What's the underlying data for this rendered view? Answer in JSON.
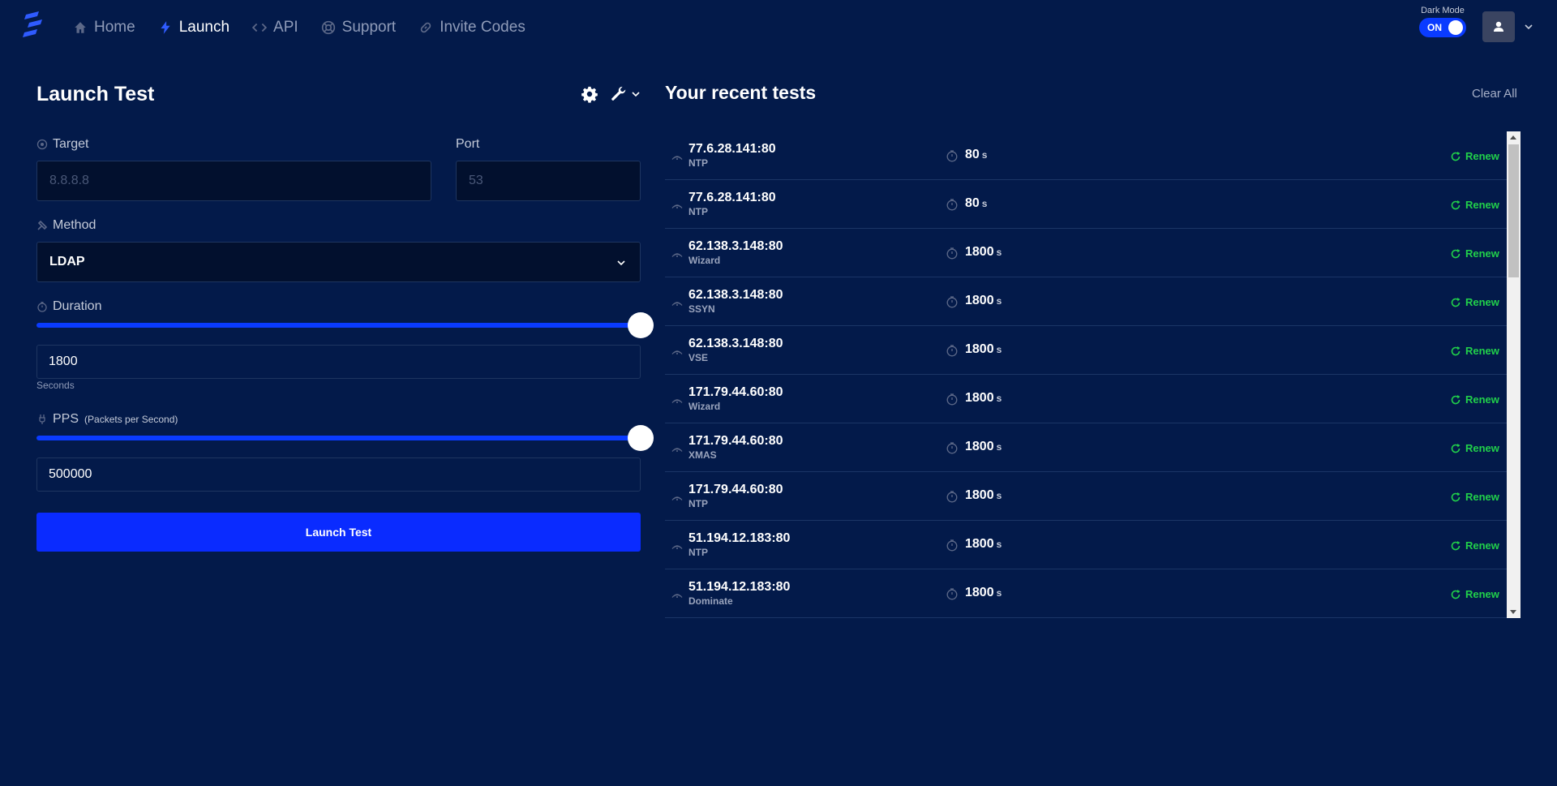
{
  "nav": {
    "items": [
      {
        "label": "Home",
        "icon": "home-icon"
      },
      {
        "label": "Launch",
        "icon": "bolt-icon"
      },
      {
        "label": "API",
        "icon": "code-icon"
      },
      {
        "label": "Support",
        "icon": "lifebuoy-icon"
      },
      {
        "label": "Invite Codes",
        "icon": "link-icon"
      }
    ],
    "active": "Launch",
    "dark_mode_label": "Dark Mode",
    "dark_mode_state": "ON"
  },
  "launch": {
    "title": "Launch Test",
    "target_label": "Target",
    "target_placeholder": "8.8.8.8",
    "port_label": "Port",
    "port_placeholder": "53",
    "method_label": "Method",
    "method_value": "LDAP",
    "duration_label": "Duration",
    "duration_value": "1800",
    "duration_unit": "Seconds",
    "duration_slider_fraction": 1.0,
    "pps_label": "PPS",
    "pps_note": "(Packets per Second)",
    "pps_value": "500000",
    "pps_slider_fraction": 1.0,
    "launch_button": "Launch Test"
  },
  "recent": {
    "title": "Your recent tests",
    "clear_all": "Clear All",
    "renew_label": "Renew",
    "duration_unit": "s",
    "tests": [
      {
        "target": "77.6.28.141:80",
        "method": "NTP",
        "duration": "80"
      },
      {
        "target": "77.6.28.141:80",
        "method": "NTP",
        "duration": "80"
      },
      {
        "target": "62.138.3.148:80",
        "method": "Wizard",
        "duration": "1800"
      },
      {
        "target": "62.138.3.148:80",
        "method": "SSYN",
        "duration": "1800"
      },
      {
        "target": "62.138.3.148:80",
        "method": "VSE",
        "duration": "1800"
      },
      {
        "target": "171.79.44.60:80",
        "method": "Wizard",
        "duration": "1800"
      },
      {
        "target": "171.79.44.60:80",
        "method": "XMAS",
        "duration": "1800"
      },
      {
        "target": "171.79.44.60:80",
        "method": "NTP",
        "duration": "1800"
      },
      {
        "target": "51.194.12.183:80",
        "method": "NTP",
        "duration": "1800"
      },
      {
        "target": "51.194.12.183:80",
        "method": "Dominate",
        "duration": "1800"
      }
    ]
  },
  "colors": {
    "background": "#031a4a",
    "accent": "#0a2bff",
    "renew": "#21d04a"
  }
}
